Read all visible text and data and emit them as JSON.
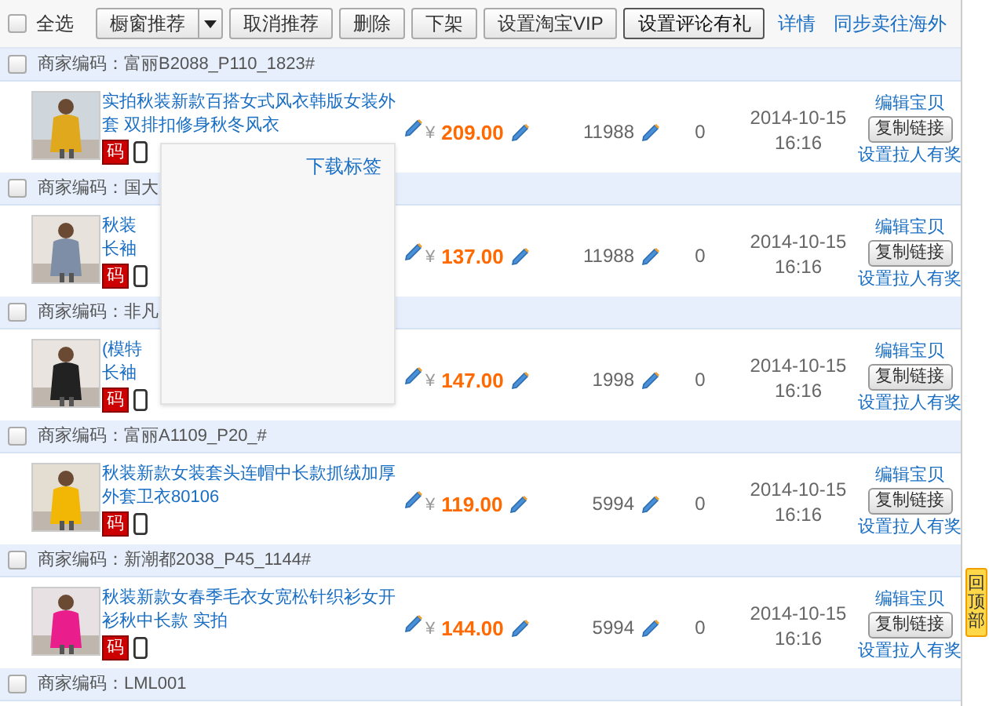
{
  "toolbar": {
    "select_all": {
      "label": "全选",
      "checked": false
    },
    "buttons": [
      {
        "label": "橱窗推荐",
        "kind": "split"
      },
      {
        "label": "取消推荐",
        "kind": "plain"
      },
      {
        "label": "删除",
        "kind": "plain"
      },
      {
        "label": "下架",
        "kind": "plain"
      },
      {
        "label": "设置淘宝VIP",
        "kind": "plain"
      },
      {
        "label": "设置评论有礼",
        "kind": "focused"
      }
    ],
    "link": "详情",
    "right_link": "同步卖往海外"
  },
  "groups": [
    {
      "header": "商家编码：富丽B2088_P110_1823#",
      "checked": false,
      "item": {
        "title_lines": [
          "实拍秋装新款百搭女式风衣韩版女装外",
          "套 双排扣修身秋冬风衣"
        ],
        "badge": "码",
        "currency": "¥",
        "price": "209.00",
        "stock": "11988",
        "sales": "0",
        "date": "2014-10-15",
        "time": "16:16",
        "edit": "编辑宝贝",
        "copy": "复制链接",
        "invite": "设置拉人有奖"
      }
    },
    {
      "header": "商家编码：国大",
      "checked": false,
      "item": {
        "title_lines": [
          "秋装",
          "长袖"
        ],
        "badge": "码",
        "currency": "¥",
        "price": "137.00",
        "stock": "11988",
        "sales": "0",
        "date": "2014-10-15",
        "time": "16:16",
        "edit": "编辑宝贝",
        "copy": "复制链接",
        "invite": "设置拉人有奖"
      }
    },
    {
      "header": "商家编码：非凡",
      "checked": false,
      "item": {
        "title_lines": [
          "(模特",
          "长袖"
        ],
        "badge": "码",
        "currency": "¥",
        "price": "147.00",
        "stock": "1998",
        "sales": "0",
        "date": "2014-10-15",
        "time": "16:16",
        "edit": "编辑宝贝",
        "copy": "复制链接",
        "invite": "设置拉人有奖"
      }
    },
    {
      "header": "商家编码：富丽A1109_P20_#",
      "checked": false,
      "item": {
        "title_lines": [
          "秋装新款女装套头连帽中长款抓绒加厚",
          "外套卫衣80106"
        ],
        "badge": "码",
        "currency": "¥",
        "price": "119.00",
        "stock": "5994",
        "sales": "0",
        "date": "2014-10-15",
        "time": "16:16",
        "edit": "编辑宝贝",
        "copy": "复制链接",
        "invite": "设置拉人有奖"
      }
    },
    {
      "header": "商家编码：新潮都2038_P45_1144#",
      "checked": false,
      "item": {
        "title_lines": [
          "秋装新款女春季毛衣女宽松针织衫女开",
          "衫秋中长款 实拍"
        ],
        "badge": "码",
        "currency": "¥",
        "price": "144.00",
        "stock": "5994",
        "sales": "0",
        "date": "2014-10-15",
        "time": "16:16",
        "edit": "编辑宝贝",
        "copy": "复制链接",
        "invite": "设置拉人有奖"
      }
    },
    {
      "header": "商家编码：LML001",
      "checked": false
    }
  ],
  "popup": {
    "link": "下载标签"
  },
  "back_to_top": "回顶部"
}
